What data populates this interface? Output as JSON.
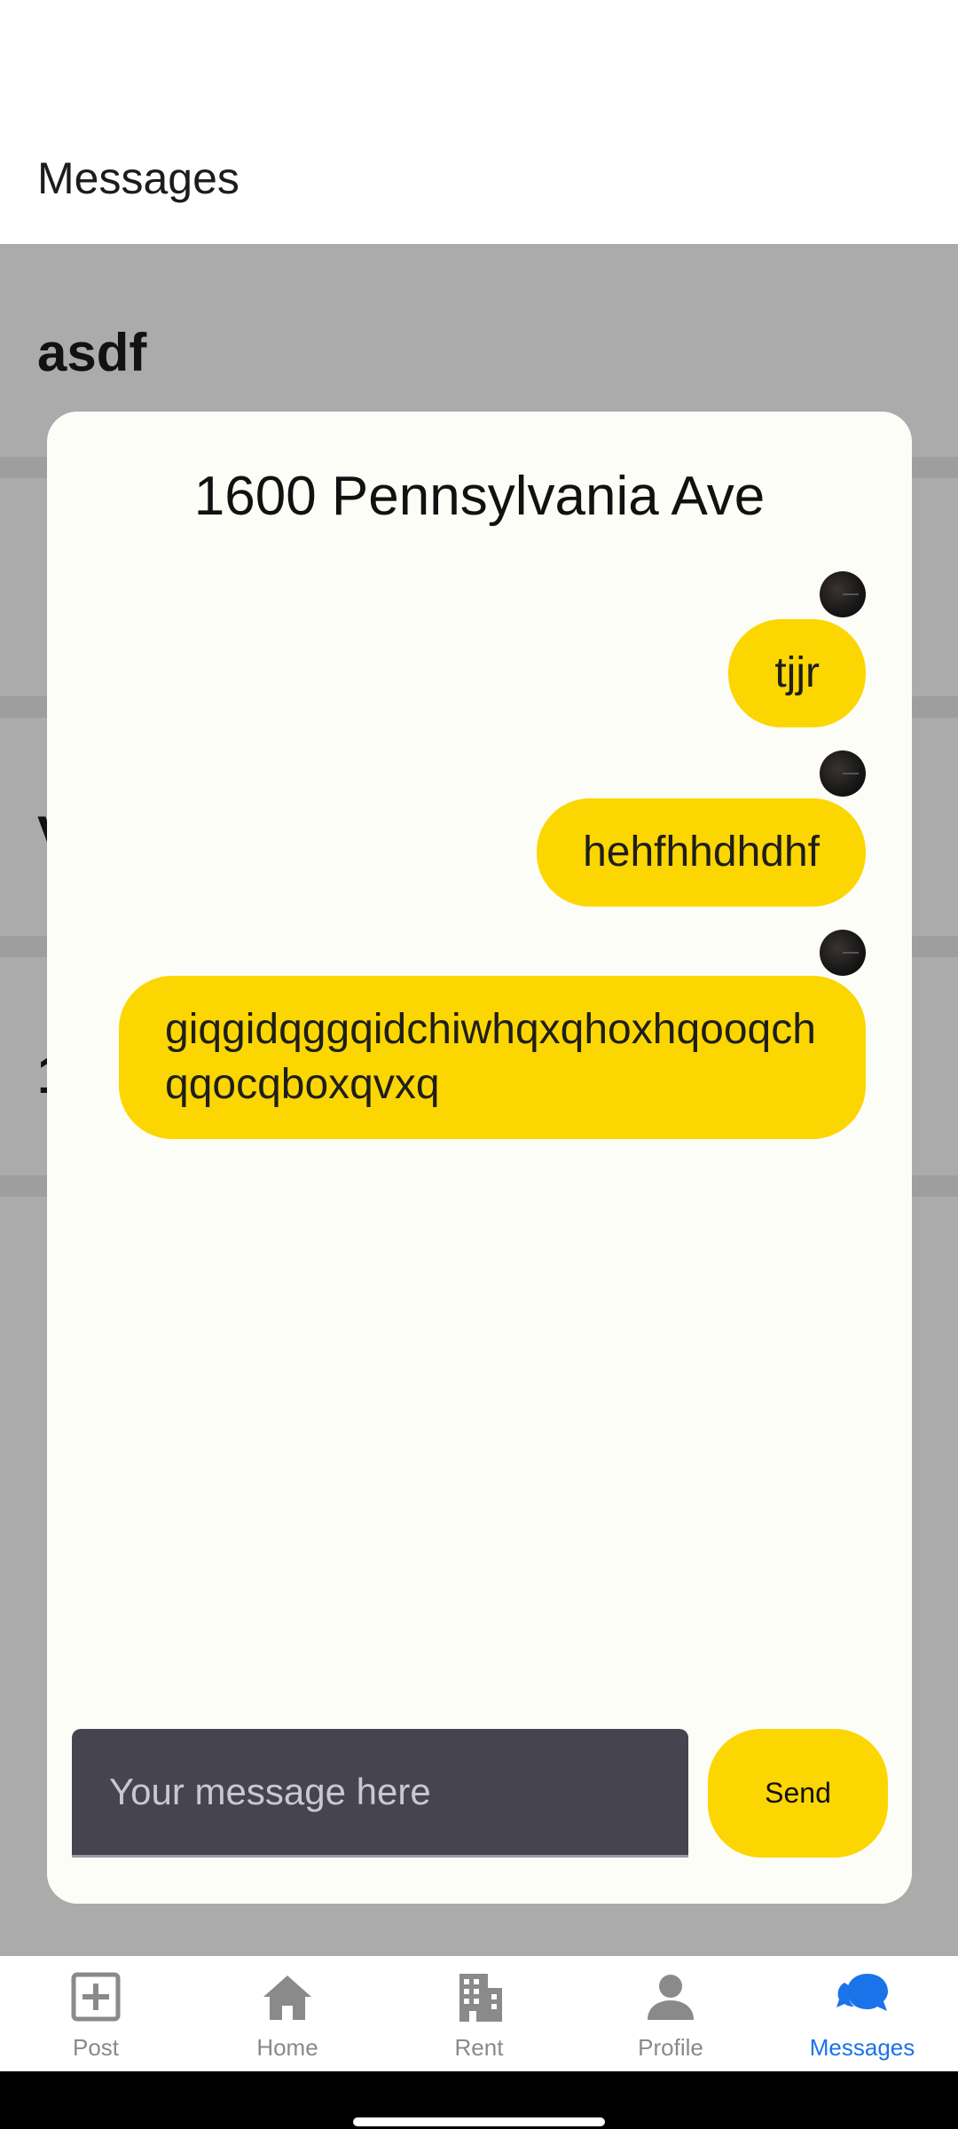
{
  "header": {
    "title": "Messages"
  },
  "conversations": [
    {
      "name": "asdf"
    },
    {
      "name": ""
    },
    {
      "name": "V"
    },
    {
      "name": "1"
    }
  ],
  "modal": {
    "title": "1600 Pennsylvania Ave",
    "messages": [
      {
        "text": "tjjr"
      },
      {
        "text": "hehfhhdhdhf"
      },
      {
        "text": "giqgidqggqidchiwhqxqhoxhqooqchqqocqboxqvxq"
      }
    ],
    "input": {
      "placeholder": "Your message here",
      "value": ""
    },
    "send_label": "Send"
  },
  "bottom_nav": {
    "items": [
      {
        "label": "Post",
        "icon": "plus-square-icon"
      },
      {
        "label": "Home",
        "icon": "home-icon"
      },
      {
        "label": "Rent",
        "icon": "building-icon"
      },
      {
        "label": "Profile",
        "icon": "person-icon"
      },
      {
        "label": "Messages",
        "icon": "chat-bubbles-icon"
      }
    ],
    "active_index": 4,
    "active_color": "#1a73e8",
    "inactive_color": "#8a8a8a"
  },
  "colors": {
    "accent": "#fcd600",
    "input_background": "#46444e",
    "modal_background": "#fdfdf8"
  }
}
